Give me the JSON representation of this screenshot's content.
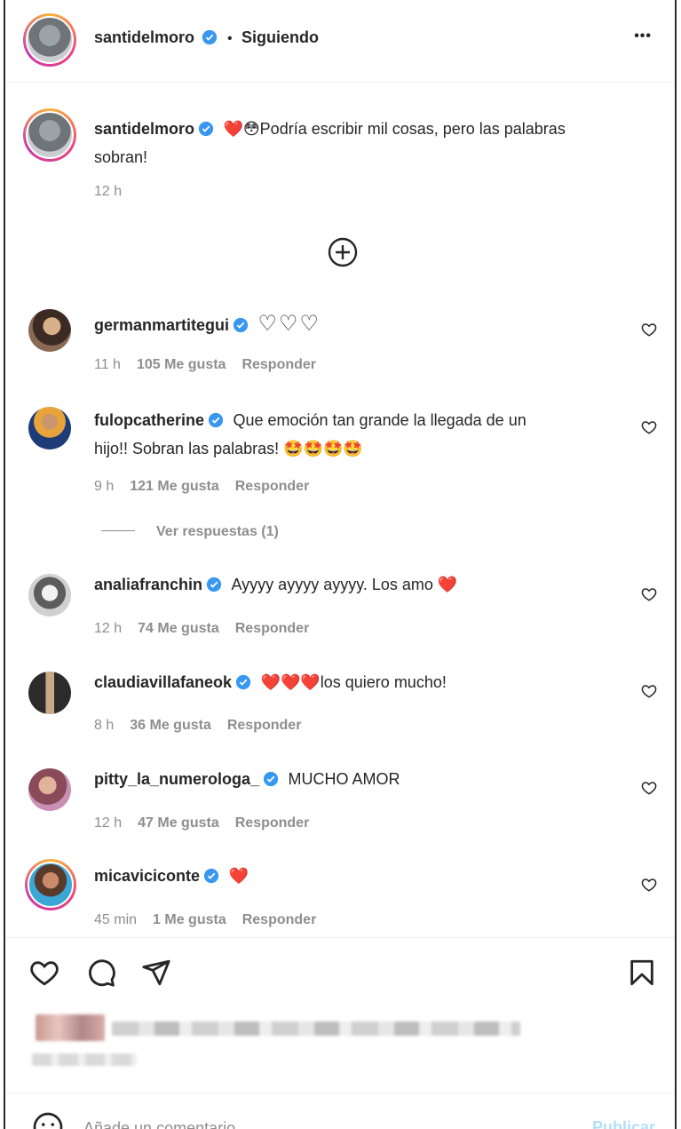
{
  "header": {
    "username": "santidelmoro",
    "separator": "•",
    "follow_status": "Siguiendo",
    "more_label": "•••"
  },
  "caption": {
    "username": "santidelmoro",
    "emojis": "❤️😳",
    "text_line1": "Podría escribir mil cosas, pero las palabras",
    "text_line2": "sobran!",
    "time": "12 h"
  },
  "load_more_icon": "plus-circle-icon",
  "comments": [
    {
      "username": "germanmartitegui",
      "text": "♡♡♡",
      "time": "11 h",
      "likes": "105 Me gusta",
      "reply": "Responder"
    },
    {
      "username": "fulopcatherine",
      "text_line1": "Que emoción tan grande la llegada de un",
      "text_line2": "hijo!! Sobran las palabras! 🤩🤩🤩🤩",
      "time": "9 h",
      "likes": "121 Me gusta",
      "reply": "Responder",
      "view_replies": "Ver respuestas (1)"
    },
    {
      "username": "analiafranchin",
      "text": "Ayyyy ayyyy ayyyy. Los amo ❤️",
      "time": "12 h",
      "likes": "74 Me gusta",
      "reply": "Responder"
    },
    {
      "username": "claudiavillafaneok",
      "text": "❤️❤️❤️los quiero mucho!",
      "time": "8 h",
      "likes": "36 Me gusta",
      "reply": "Responder"
    },
    {
      "username": "pitty_la_numerologa_",
      "text": "MUCHO AMOR",
      "time": "12 h",
      "likes": "47 Me gusta",
      "reply": "Responder"
    },
    {
      "username": "micaviciconte",
      "text": "❤️",
      "time": "45 min",
      "likes": "1 Me gusta",
      "reply": "Responder"
    }
  ],
  "actions": {
    "like_icon": "heart-icon",
    "comment_icon": "comment-icon",
    "share_icon": "send-icon",
    "save_icon": "bookmark-icon"
  },
  "composer": {
    "placeholder": "Añade un comentario...",
    "publish_label": "Publicar"
  },
  "colors": {
    "verified": "#3897f0",
    "heart_red": "#ed4956",
    "publish": "#b2dffc",
    "meta": "#8e8e8e"
  }
}
